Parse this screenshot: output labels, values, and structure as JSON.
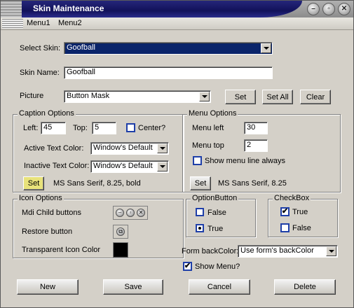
{
  "window": {
    "title": "Skin Maintenance"
  },
  "title_buttons": {
    "minimize": "–",
    "restore": "▫",
    "close": "✕"
  },
  "menu": {
    "items": [
      "Menu1",
      "Menu2"
    ]
  },
  "skin": {
    "select_label": "Select Skin:",
    "select_value": "Goofball",
    "name_label": "Skin Name:",
    "name_value": "Goofball",
    "picture_label": "Picture",
    "picture_value": "Button Mask",
    "set_label": "Set",
    "set_all_label": "Set All",
    "clear_label": "Clear"
  },
  "caption": {
    "title": "Caption Options",
    "left_label": "Left:",
    "left_value": "45",
    "top_label": "Top:",
    "top_value": "5",
    "center_label": "Center?",
    "center_checked": false,
    "active_label": "Active Text Color:",
    "active_value": "Window's Default",
    "inactive_label": "Inactive Text Color:",
    "inactive_value": "Window's Default",
    "set_label": "Set",
    "font_text": "MS Sans Serif, 8.25, bold"
  },
  "menu_options": {
    "title": "Menu Options",
    "left_label": "Menu left",
    "left_value": "30",
    "top_label": "Menu top",
    "top_value": "2",
    "show_line_label": "Show menu line always",
    "show_line_checked": false,
    "set_label": "Set",
    "font_text": "MS Sans Serif, 8.25"
  },
  "icon_options": {
    "title": "Icon Options",
    "mdi_label": "Mdi Child buttons",
    "restore_label": "Restore button",
    "transparent_label": "Transparent Icon Color",
    "transparent_color": "#000000"
  },
  "option_button": {
    "title": "OptionButton",
    "false_label": "False",
    "true_label": "True",
    "selected": "True"
  },
  "checkbox": {
    "title": "CheckBox",
    "true_label": "True",
    "true_checked": true,
    "false_label": "False",
    "false_checked": false
  },
  "form_back": {
    "label": "Form backColor:",
    "value": "Use form's backColor"
  },
  "show_menu": {
    "label": "Show Menu?",
    "checked": true
  },
  "actions": {
    "new": "New",
    "save": "Save",
    "cancel": "Cancel",
    "delete": "Delete"
  },
  "colors": {
    "title_blue": "#12125a",
    "selection": "#0a246a",
    "accent_border": "#1f3fa8",
    "yellow_button": "#e8e27a"
  }
}
